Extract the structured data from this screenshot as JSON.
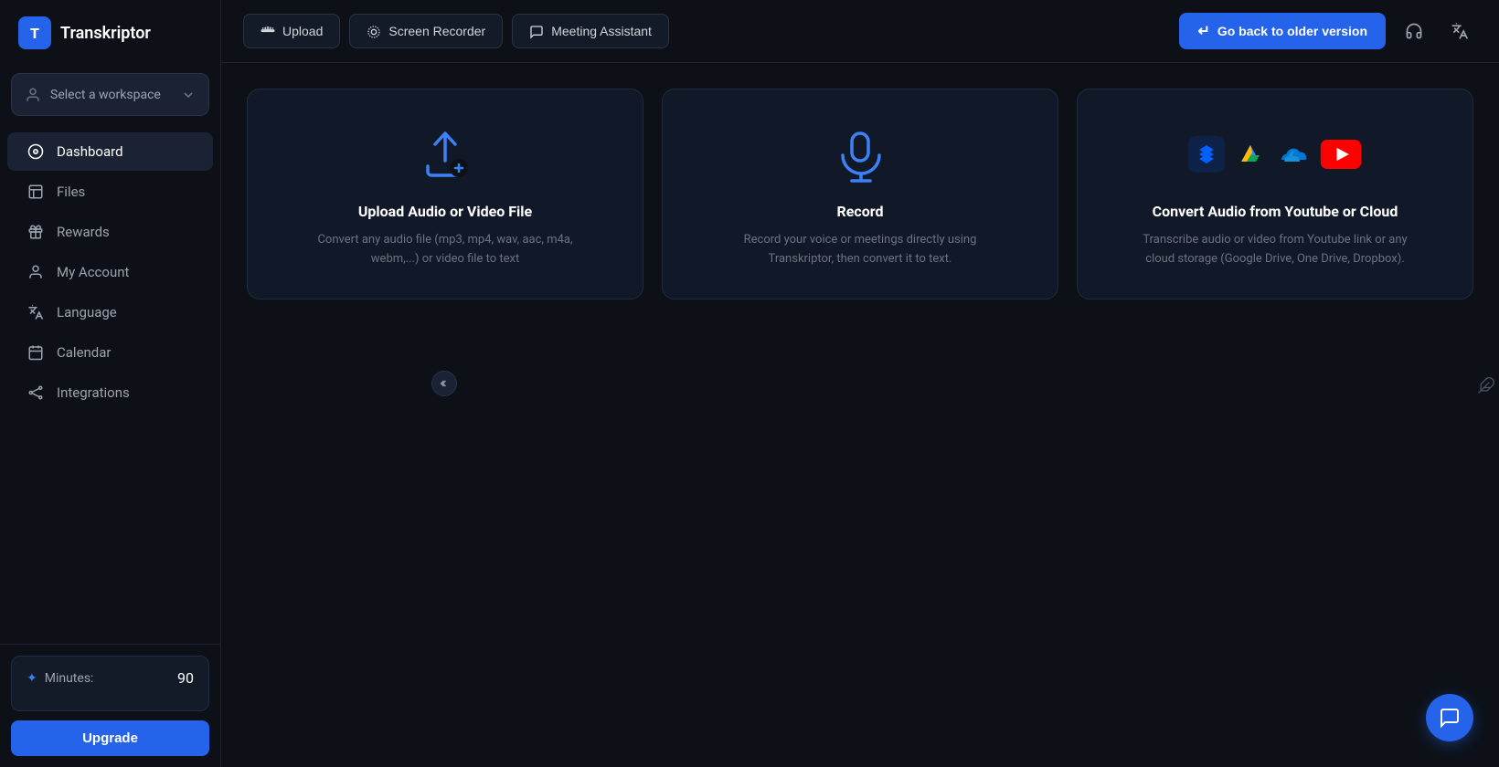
{
  "app": {
    "logo_text": "Transkriptor",
    "logo_letter": "T"
  },
  "sidebar": {
    "workspace": {
      "label": "Select a workspace",
      "chevron": "▾"
    },
    "nav_items": [
      {
        "id": "dashboard",
        "label": "Dashboard",
        "active": true
      },
      {
        "id": "files",
        "label": "Files",
        "active": false
      },
      {
        "id": "rewards",
        "label": "Rewards",
        "active": false
      },
      {
        "id": "my-account",
        "label": "My Account",
        "active": false
      },
      {
        "id": "language",
        "label": "Language",
        "active": false
      },
      {
        "id": "calendar",
        "label": "Calendar",
        "active": false
      },
      {
        "id": "integrations",
        "label": "Integrations",
        "active": false
      }
    ],
    "minutes_label": "Minutes:",
    "minutes_value": "90",
    "upgrade_label": "Upgrade"
  },
  "topbar": {
    "buttons": [
      {
        "id": "upload",
        "label": "Upload"
      },
      {
        "id": "screen-recorder",
        "label": "Screen Recorder"
      },
      {
        "id": "meeting-assistant",
        "label": "Meeting Assistant"
      }
    ],
    "go_back_label": "Go back to older version"
  },
  "cards": [
    {
      "id": "upload-card",
      "title": "Upload Audio or Video File",
      "description": "Convert any audio file (mp3, mp4, wav, aac, m4a, webm,...) or video file to text"
    },
    {
      "id": "record-card",
      "title": "Record",
      "description": "Record your voice or meetings directly using Transkriptor, then convert it to text."
    },
    {
      "id": "cloud-card",
      "title": "Convert Audio from Youtube or Cloud",
      "description": "Transcribe audio or video from Youtube link or any cloud storage (Google Drive, One Drive, Dropbox)."
    }
  ]
}
